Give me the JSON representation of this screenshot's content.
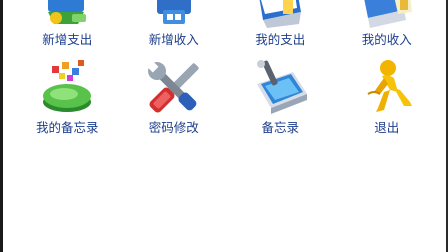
{
  "menu": {
    "items": [
      {
        "label": "新增支出",
        "icon": "add-expense-icon"
      },
      {
        "label": "新增收入",
        "icon": "add-income-icon"
      },
      {
        "label": "我的支出",
        "icon": "my-expense-icon"
      },
      {
        "label": "我的收入",
        "icon": "my-income-icon"
      },
      {
        "label": "我的备忘录",
        "icon": "pie-chart-icon"
      },
      {
        "label": "密码修改",
        "icon": "tools-icon"
      },
      {
        "label": "备忘录",
        "icon": "memo-icon"
      },
      {
        "label": "退出",
        "icon": "exit-person-icon"
      }
    ]
  }
}
